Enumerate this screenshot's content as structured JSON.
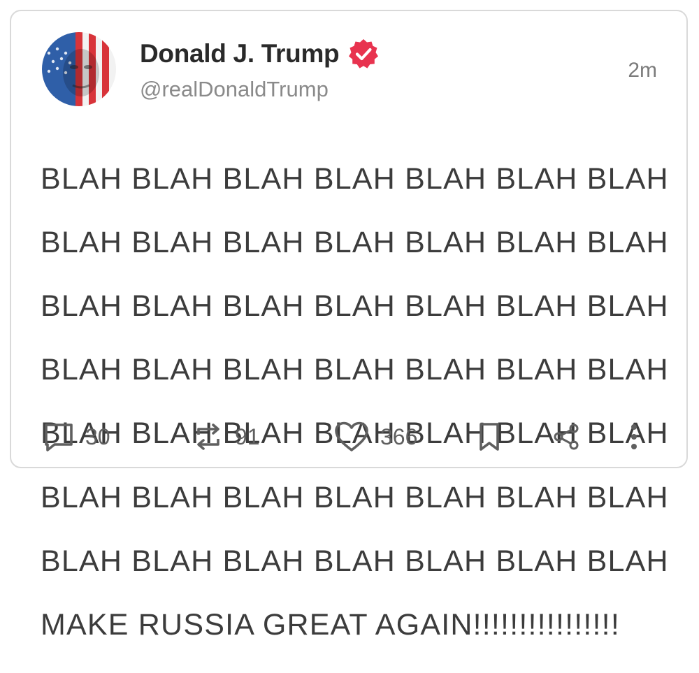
{
  "tweet": {
    "display_name": "Donald J. Trump",
    "handle": "@realDonaldTrump",
    "timestamp": "2m",
    "text_lines": [
      "BLAH BLAH BLAH BLAH BLAH BLAH BLAH",
      "BLAH BLAH BLAH BLAH BLAH BLAH BLAH",
      "BLAH BLAH BLAH BLAH BLAH BLAH BLAH",
      "BLAH BLAH BLAH BLAH BLAH BLAH BLAH",
      "BLAH BLAH BLAH BLAH BLAH BLAH BLAH",
      "BLAH BLAH BLAH BLAH BLAH BLAH BLAH",
      "BLAH BLAH BLAH BLAH BLAH BLAH BLAH",
      "MAKE RUSSIA GREAT AGAIN!!!!!!!!!!!!!!!!"
    ],
    "verified_icon": "verified-badge-icon",
    "verified_color": "#e8334f"
  },
  "actions": {
    "reply": {
      "icon": "reply-icon",
      "count": "30"
    },
    "retweet": {
      "icon": "retweet-icon",
      "count": "91"
    },
    "like": {
      "icon": "heart-icon",
      "count": "366"
    },
    "bookmark": {
      "icon": "bookmark-icon"
    },
    "share": {
      "icon": "share-icon"
    },
    "more": {
      "icon": "more-vertical-icon"
    }
  }
}
